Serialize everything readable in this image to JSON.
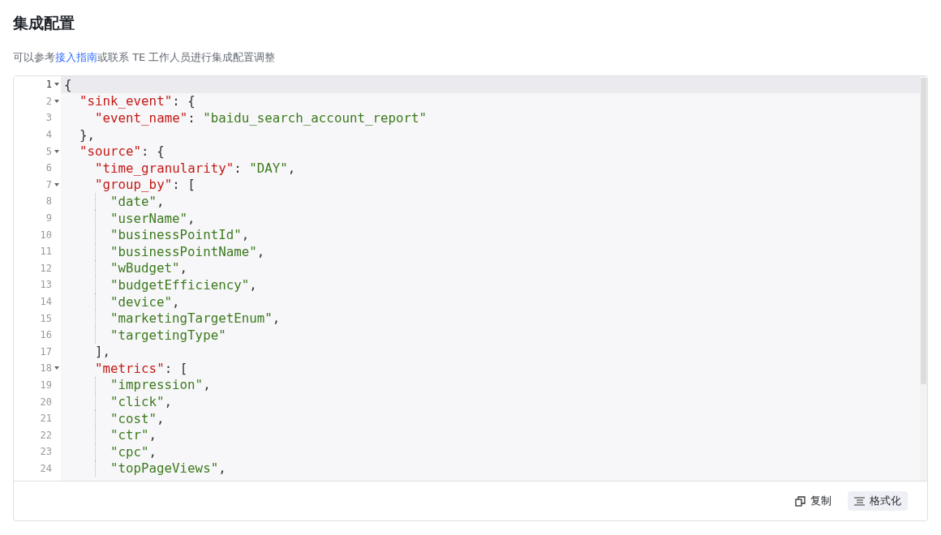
{
  "title": "集成配置",
  "description": {
    "before": "可以参考",
    "link": "接入指南",
    "after": "或联系 TE 工作人员进行集成配置调整"
  },
  "editor": {
    "lines": [
      {
        "number": "1",
        "foldable": true,
        "active": true,
        "guide": false,
        "tokens": [
          {
            "kind": "punct",
            "text": "{"
          }
        ]
      },
      {
        "number": "2",
        "foldable": true,
        "active": false,
        "guide": false,
        "tokens": [
          {
            "kind": "key",
            "text": "  \"sink_event\""
          },
          {
            "kind": "punct",
            "text": ": {"
          }
        ]
      },
      {
        "number": "3",
        "foldable": false,
        "active": false,
        "guide": false,
        "tokens": [
          {
            "kind": "key",
            "text": "    \"event_name\""
          },
          {
            "kind": "punct",
            "text": ": "
          },
          {
            "kind": "string",
            "text": "\"baidu_search_account_report\""
          }
        ]
      },
      {
        "number": "4",
        "foldable": false,
        "active": false,
        "guide": false,
        "tokens": [
          {
            "kind": "punct",
            "text": "  },"
          }
        ]
      },
      {
        "number": "5",
        "foldable": true,
        "active": false,
        "guide": false,
        "tokens": [
          {
            "kind": "key",
            "text": "  \"source\""
          },
          {
            "kind": "punct",
            "text": ": {"
          }
        ]
      },
      {
        "number": "6",
        "foldable": false,
        "active": false,
        "guide": false,
        "tokens": [
          {
            "kind": "key",
            "text": "    \"time_granularity\""
          },
          {
            "kind": "punct",
            "text": ": "
          },
          {
            "kind": "string",
            "text": "\"DAY\""
          },
          {
            "kind": "punct",
            "text": ","
          }
        ]
      },
      {
        "number": "7",
        "foldable": true,
        "active": false,
        "guide": false,
        "tokens": [
          {
            "kind": "key",
            "text": "    \"group_by\""
          },
          {
            "kind": "punct",
            "text": ": ["
          }
        ]
      },
      {
        "number": "8",
        "foldable": false,
        "active": false,
        "guide": true,
        "tokens": [
          {
            "kind": "string",
            "text": "\"date\""
          },
          {
            "kind": "punct",
            "text": ","
          }
        ]
      },
      {
        "number": "9",
        "foldable": false,
        "active": false,
        "guide": true,
        "tokens": [
          {
            "kind": "string",
            "text": "\"userName\""
          },
          {
            "kind": "punct",
            "text": ","
          }
        ]
      },
      {
        "number": "10",
        "foldable": false,
        "active": false,
        "guide": true,
        "tokens": [
          {
            "kind": "string",
            "text": "\"businessPointId\""
          },
          {
            "kind": "punct",
            "text": ","
          }
        ]
      },
      {
        "number": "11",
        "foldable": false,
        "active": false,
        "guide": true,
        "tokens": [
          {
            "kind": "string",
            "text": "\"businessPointName\""
          },
          {
            "kind": "punct",
            "text": ","
          }
        ]
      },
      {
        "number": "12",
        "foldable": false,
        "active": false,
        "guide": true,
        "tokens": [
          {
            "kind": "string",
            "text": "\"wBudget\""
          },
          {
            "kind": "punct",
            "text": ","
          }
        ]
      },
      {
        "number": "13",
        "foldable": false,
        "active": false,
        "guide": true,
        "tokens": [
          {
            "kind": "string",
            "text": "\"budgetEfficiency\""
          },
          {
            "kind": "punct",
            "text": ","
          }
        ]
      },
      {
        "number": "14",
        "foldable": false,
        "active": false,
        "guide": true,
        "tokens": [
          {
            "kind": "string",
            "text": "\"device\""
          },
          {
            "kind": "punct",
            "text": ","
          }
        ]
      },
      {
        "number": "15",
        "foldable": false,
        "active": false,
        "guide": true,
        "tokens": [
          {
            "kind": "string",
            "text": "\"marketingTargetEnum\""
          },
          {
            "kind": "punct",
            "text": ","
          }
        ]
      },
      {
        "number": "16",
        "foldable": false,
        "active": false,
        "guide": true,
        "tokens": [
          {
            "kind": "string",
            "text": "\"targetingType\""
          }
        ]
      },
      {
        "number": "17",
        "foldable": false,
        "active": false,
        "guide": false,
        "tokens": [
          {
            "kind": "punct",
            "text": "    ],"
          }
        ]
      },
      {
        "number": "18",
        "foldable": true,
        "active": false,
        "guide": false,
        "tokens": [
          {
            "kind": "key",
            "text": "    \"metrics\""
          },
          {
            "kind": "punct",
            "text": ": ["
          }
        ]
      },
      {
        "number": "19",
        "foldable": false,
        "active": false,
        "guide": true,
        "tokens": [
          {
            "kind": "string",
            "text": "\"impression\""
          },
          {
            "kind": "punct",
            "text": ","
          }
        ]
      },
      {
        "number": "20",
        "foldable": false,
        "active": false,
        "guide": true,
        "tokens": [
          {
            "kind": "string",
            "text": "\"click\""
          },
          {
            "kind": "punct",
            "text": ","
          }
        ]
      },
      {
        "number": "21",
        "foldable": false,
        "active": false,
        "guide": true,
        "tokens": [
          {
            "kind": "string",
            "text": "\"cost\""
          },
          {
            "kind": "punct",
            "text": ","
          }
        ]
      },
      {
        "number": "22",
        "foldable": false,
        "active": false,
        "guide": true,
        "tokens": [
          {
            "kind": "string",
            "text": "\"ctr\""
          },
          {
            "kind": "punct",
            "text": ","
          }
        ]
      },
      {
        "number": "23",
        "foldable": false,
        "active": false,
        "guide": true,
        "tokens": [
          {
            "kind": "string",
            "text": "\"cpc\""
          },
          {
            "kind": "punct",
            "text": ","
          }
        ]
      },
      {
        "number": "24",
        "foldable": false,
        "active": false,
        "guide": true,
        "tokens": [
          {
            "kind": "string",
            "text": "\"topPageViews\""
          },
          {
            "kind": "punct",
            "text": ","
          }
        ]
      }
    ]
  },
  "actions": [
    {
      "kind": "copy",
      "label": "复制",
      "selected": false
    },
    {
      "kind": "format",
      "label": "格式化",
      "selected": true
    }
  ]
}
